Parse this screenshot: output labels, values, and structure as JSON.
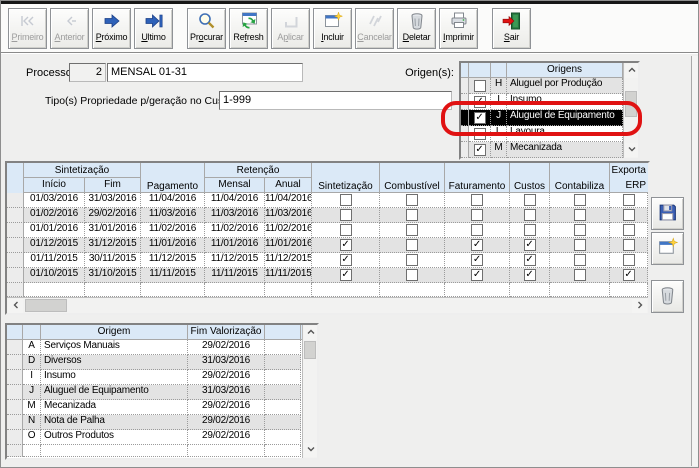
{
  "toolbar": {
    "buttons": [
      {
        "label": "Primeiro",
        "hot": 0,
        "disabled": true
      },
      {
        "label": "Anterior",
        "hot": 0,
        "disabled": true
      },
      {
        "label": "Próximo",
        "hot": 0,
        "disabled": false
      },
      {
        "label": "Ultimo",
        "hot": 0,
        "disabled": false
      },
      {
        "label": "Procurar",
        "hot": 2,
        "disabled": false
      },
      {
        "label": "Refresh",
        "hot": 2,
        "disabled": false
      },
      {
        "label": "Aplicar",
        "hot": 1,
        "disabled": true
      },
      {
        "label": "Incluir",
        "hot": 0,
        "disabled": false
      },
      {
        "label": "Cancelar",
        "hot": 0,
        "disabled": true
      },
      {
        "label": "Deletar",
        "hot": 0,
        "disabled": false
      },
      {
        "label": "Imprimir",
        "hot": 0,
        "disabled": false
      },
      {
        "label": "Sair",
        "hot": 0,
        "disabled": false
      }
    ]
  },
  "process": {
    "label": "Processo:",
    "number": "2",
    "name": "MENSAL 01-31"
  },
  "tipo": {
    "label": "Tipo(s) Propriedade p/geração no Custag:",
    "value": "1-999"
  },
  "origens_panel": {
    "label": "Origen(s):",
    "header": "Origens",
    "items": [
      {
        "code": "H",
        "name": "Aluguel por Produção",
        "checked": false,
        "selected": false
      },
      {
        "code": "I",
        "name": "Insumo",
        "checked": true,
        "selected": false
      },
      {
        "code": "J",
        "name": "Aluguel de Equipamento",
        "checked": true,
        "selected": true
      },
      {
        "code": "L",
        "name": "Lavoura",
        "checked": false,
        "selected": false
      },
      {
        "code": "M",
        "name": "Mecanizada",
        "checked": true,
        "selected": false
      }
    ]
  },
  "main_table": {
    "group_sintetizacao": "Sintetização",
    "group_retencao": "Retenção",
    "columns": [
      "Início",
      "Fim",
      "Pagamento",
      "Mensal",
      "Anual",
      "Sintetização",
      "Combustível",
      "Faturamento",
      "Custos",
      "Contabiliza"
    ],
    "col_erp": {
      "line1": "Exporta",
      "line2": "ERP"
    },
    "check_columns": [
      "sintetizacao",
      "combustivel",
      "faturamento",
      "custos",
      "contabiliza",
      "exporta-erp"
    ],
    "rows": [
      {
        "inicio": "01/03/2016",
        "fim": "31/03/2016",
        "pagamento": "11/04/2016",
        "mensal": "11/04/2016",
        "anual": "11/04/2016",
        "checks": [
          false,
          false,
          false,
          false,
          false,
          false
        ]
      },
      {
        "inicio": "01/02/2016",
        "fim": "29/02/2016",
        "pagamento": "11/03/2016",
        "mensal": "11/03/2016",
        "anual": "11/03/2016",
        "checks": [
          false,
          false,
          false,
          false,
          false,
          false
        ]
      },
      {
        "inicio": "01/01/2016",
        "fim": "31/01/2016",
        "pagamento": "11/02/2016",
        "mensal": "11/02/2016",
        "anual": "11/02/2016",
        "checks": [
          false,
          false,
          false,
          false,
          false,
          false
        ]
      },
      {
        "inicio": "01/12/2015",
        "fim": "31/12/2015",
        "pagamento": "11/01/2016",
        "mensal": "11/01/2016",
        "anual": "11/01/2016",
        "checks": [
          true,
          false,
          true,
          true,
          false,
          false
        ]
      },
      {
        "inicio": "01/11/2015",
        "fim": "30/11/2015",
        "pagamento": "11/12/2015",
        "mensal": "11/12/2015",
        "anual": "11/12/2015",
        "checks": [
          true,
          false,
          true,
          true,
          false,
          false
        ]
      },
      {
        "inicio": "01/10/2015",
        "fim": "31/10/2015",
        "pagamento": "11/11/2015",
        "mensal": "11/11/2015",
        "anual": "11/11/2015",
        "checks": [
          true,
          false,
          true,
          true,
          false,
          true
        ]
      }
    ]
  },
  "bottom_table": {
    "columns": {
      "origem": "Origem",
      "fim": "Fim Valorização"
    },
    "rows": [
      {
        "code": "A",
        "origem": "Serviços Manuais",
        "fim": "29/02/2016"
      },
      {
        "code": "D",
        "origem": "Diversos",
        "fim": "31/03/2016"
      },
      {
        "code": "I",
        "origem": "Insumo",
        "fim": "29/02/2016"
      },
      {
        "code": "J",
        "origem": "Aluguel de Equipamento",
        "fim": "31/03/2016"
      },
      {
        "code": "M",
        "origem": "Mecanizada",
        "fim": "29/02/2016"
      },
      {
        "code": "N",
        "origem": "Nota de Palha",
        "fim": "29/02/2016"
      },
      {
        "code": "O",
        "origem": "Outros Produtos",
        "fim": "29/02/2016"
      }
    ]
  },
  "colors": {
    "header_blue": "#dbe9f7",
    "row_alt_gray": "#e3e3e3",
    "selection_black": "#000000",
    "annotation_red": "#e01212",
    "arrow_blue": "#2e61b8",
    "refresh_green": "#27a343"
  }
}
